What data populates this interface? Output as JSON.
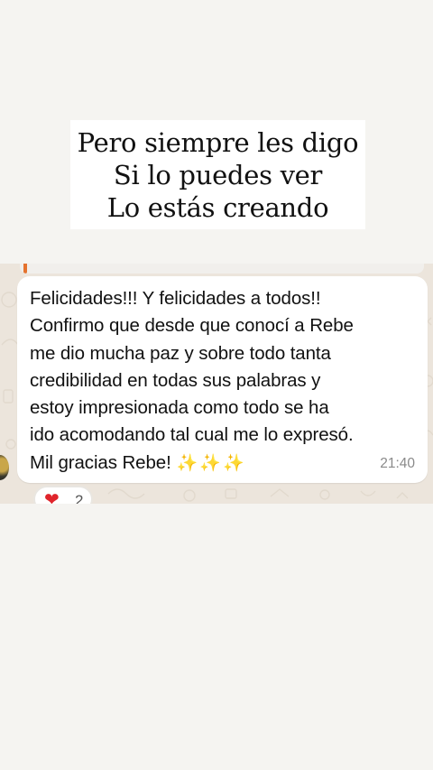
{
  "caption": {
    "lines": [
      "Pero siempre les digo",
      "Si lo puedes ver",
      "Lo estás creando"
    ]
  },
  "message": {
    "lines": [
      "Felicidades!!! Y felicidades a todos!!",
      "Confirmo que desde que conocí a Rebe",
      "me dio mucha paz y sobre todo tanta",
      "credibilidad en todas sus palabras y",
      "estoy impresionada como todo se ha",
      "ido acomodando tal cual me lo expresó.",
      "Mil gracias Rebe!"
    ],
    "emoji": "✨✨✨",
    "time": "21:40"
  },
  "reaction": {
    "emoji": "❤",
    "count": "2"
  },
  "colors": {
    "page_background": "#f5f4f1",
    "chat_background": "#ece5dc",
    "quote_accent": "#e5732f",
    "heart": "#e0242b"
  }
}
